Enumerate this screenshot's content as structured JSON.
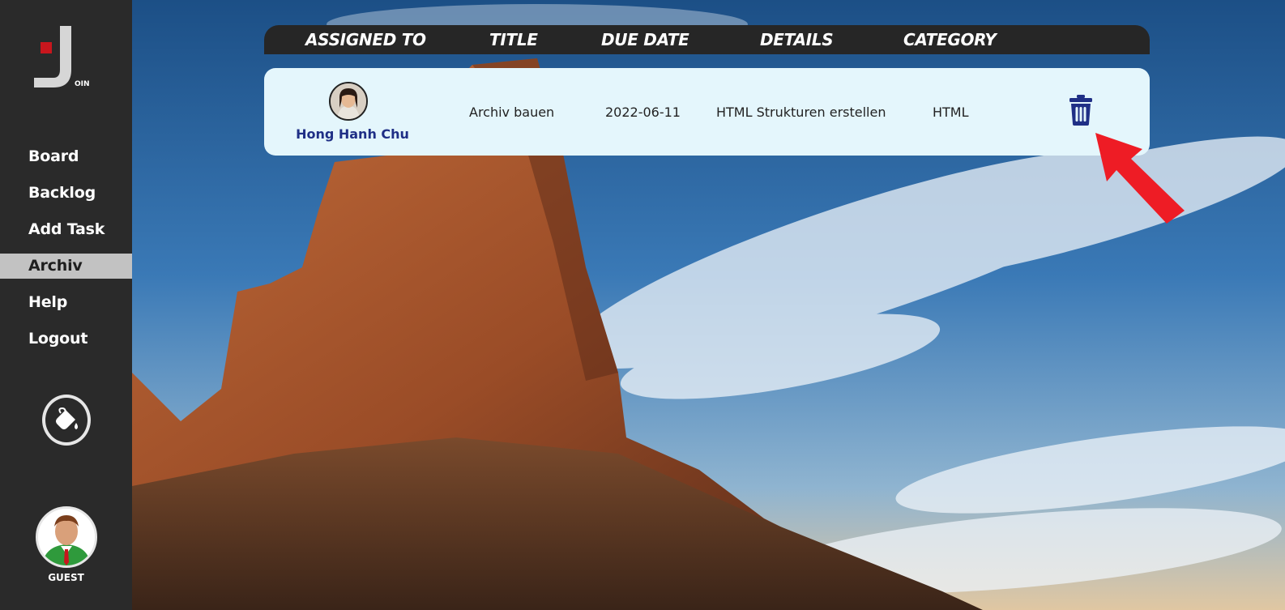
{
  "logo": {
    "text": "OIN"
  },
  "nav": {
    "items": [
      {
        "label": "Board"
      },
      {
        "label": "Backlog"
      },
      {
        "label": "Add Task"
      },
      {
        "label": "Archiv",
        "active": true
      },
      {
        "label": "Help"
      },
      {
        "label": "Logout"
      }
    ]
  },
  "theme_button": {
    "icon": "paint-bucket-icon"
  },
  "user": {
    "label": "GUEST",
    "icon": "guest-avatar-icon"
  },
  "table": {
    "headers": {
      "assigned_to": "ASSIGNED TO",
      "title": "TITLE",
      "due_date": "DUE DATE",
      "details": "DETAILS",
      "category": "CATEGORY"
    },
    "rows": [
      {
        "assignee": "Hong Hanh Chu",
        "title": "Archiv bauen",
        "due_date": "2022-06-11",
        "details": "HTML Strukturen erstellen",
        "category": "HTML",
        "action_icon": "trash-icon"
      }
    ]
  },
  "colors": {
    "sidebar": "#2a2a2a",
    "header": "#262626",
    "row_bg": "#e4f6fc",
    "assignee": "#1f2f86",
    "trash": "#1f2f86",
    "arrow": "#ee1c25",
    "logo_accent": "#c8161d"
  }
}
